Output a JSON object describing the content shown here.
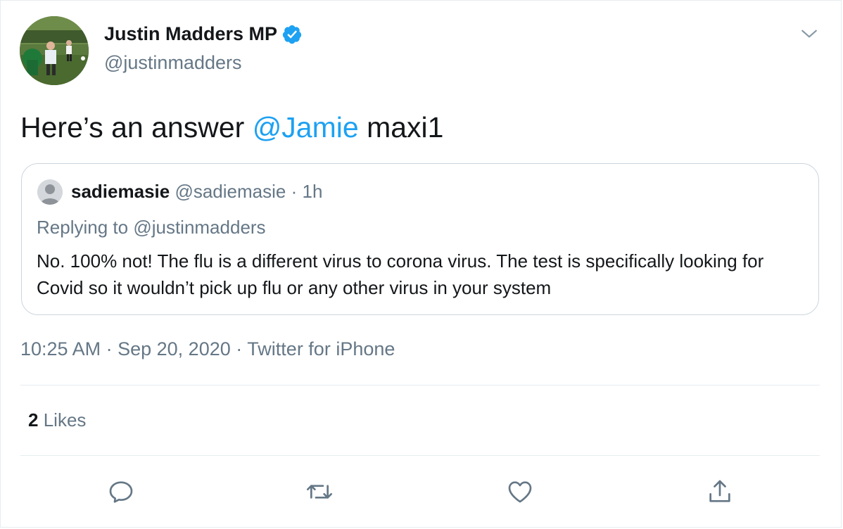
{
  "author": {
    "display_name": "Justin Madders MP",
    "handle": "@justinmadders",
    "verified": true,
    "avatar": "profile-photo-football"
  },
  "tweet": {
    "text_before": "Here’s an answer ",
    "mention": "@Jamie",
    "text_after": " maxi1"
  },
  "quote": {
    "name": "sadiemasie",
    "handle": "@sadiemasie",
    "separator": "·",
    "time": "1h",
    "replying_to_prefix": "Replying to ",
    "replying_to_handle": "@justinmadders",
    "text": "No. 100% not! The flu is a different virus to corona virus. The test is specifically looking for Covid so it wouldn’t pick up flu or any other virus in your system",
    "avatar": "default-avatar"
  },
  "meta": {
    "time": "10:25 AM",
    "separator": "·",
    "date": "Sep 20, 2020",
    "source": "Twitter for iPhone"
  },
  "stats": {
    "likes_count": "2",
    "likes_label": "Likes"
  },
  "actions": {
    "reply_icon": "reply-icon",
    "retweet_icon": "retweet-icon",
    "like_icon": "heart-icon",
    "share_icon": "share-icon"
  },
  "colors": {
    "link": "#1da1f2",
    "secondary_text": "#657786",
    "border": "#e6ecf0",
    "verified_badge": "#1da1f2"
  }
}
